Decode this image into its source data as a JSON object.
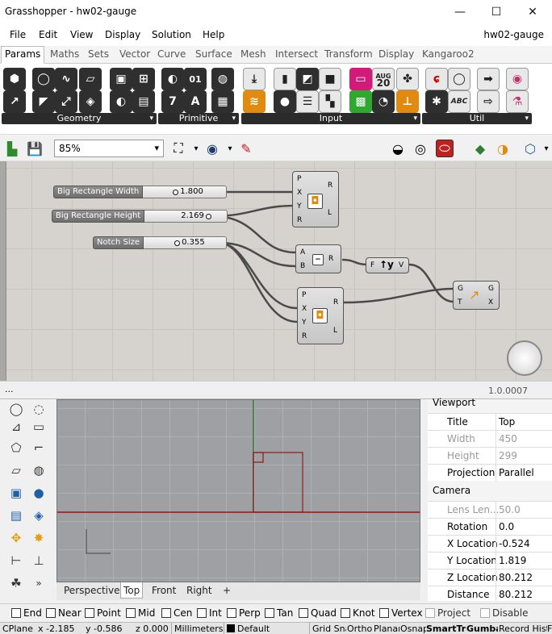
{
  "window": {
    "title": "Grasshopper - hw02-gauge",
    "minimize": "—",
    "maximize": "☐",
    "close": "✕"
  },
  "menu": {
    "items": [
      "File",
      "Edit",
      "View",
      "Display",
      "Solution",
      "Help"
    ],
    "doc_name": "hw02-gauge"
  },
  "tabs": [
    "Params",
    "Maths",
    "Sets",
    "Vector",
    "Curve",
    "Surface",
    "Mesh",
    "Intersect",
    "Transform",
    "Display",
    "Kangaroo2"
  ],
  "ribbon": {
    "panels": [
      "Geometry",
      "Primitive",
      "Input",
      "Util"
    ],
    "input_icons": {
      "calendar_month": "AUG",
      "calendar_day": "20",
      "abc": "ABC"
    },
    "primitive_icons": {
      "binary": "01",
      "seven": "7",
      "letter": "A"
    }
  },
  "toolbar": {
    "zoom": "85%"
  },
  "canvas": {
    "sliders": [
      {
        "label": "Big Rectangle Width",
        "value": "1.800"
      },
      {
        "label": "Big Rectangle Height",
        "value": "2.169"
      },
      {
        "label": "Notch Size",
        "value": "0.355"
      }
    ],
    "rect1": {
      "inputs": [
        "P",
        "X",
        "Y",
        "R"
      ],
      "outputs": [
        "R",
        "L"
      ]
    },
    "subtract": {
      "inputs": [
        "A",
        "B"
      ],
      "outputs": [
        "R"
      ],
      "symbol": "−"
    },
    "unit_y": {
      "inputs": [
        "F"
      ],
      "outputs": [
        "V"
      ],
      "symbol": "↑y"
    },
    "rect2": {
      "inputs": [
        "P",
        "X",
        "Y",
        "R"
      ],
      "outputs": [
        "R",
        "L"
      ]
    },
    "move": {
      "inputs": [
        "G",
        "T"
      ],
      "outputs": [
        "G",
        "X"
      ]
    },
    "status_dots": "...",
    "version": "1.0.0007"
  },
  "viewport": {
    "tabs": [
      "Perspective",
      "Top",
      "Front",
      "Right"
    ],
    "active_tab": "Top",
    "add_tab": "+"
  },
  "properties": {
    "viewport_header": "Viewport",
    "rows1": [
      {
        "k": "Title",
        "v": "Top",
        "dim": false
      },
      {
        "k": "Width",
        "v": "450",
        "dim": true
      },
      {
        "k": "Height",
        "v": "299",
        "dim": true
      },
      {
        "k": "Projection",
        "v": "Parallel",
        "dim": false
      }
    ],
    "camera_header": "Camera",
    "rows2": [
      {
        "k": "Lens Len...",
        "v": "50.0",
        "dim": true
      },
      {
        "k": "Rotation",
        "v": "0.0",
        "dim": false
      },
      {
        "k": "X Location",
        "v": "-0.524",
        "dim": false
      },
      {
        "k": "Y Location",
        "v": "1.819",
        "dim": false
      },
      {
        "k": "Z Location",
        "v": "80.212",
        "dim": false
      },
      {
        "k": "Distance",
        "v": "80.212",
        "dim": false
      }
    ]
  },
  "osnap": {
    "items": [
      "End",
      "Near",
      "Point",
      "Mid",
      "Cen",
      "Int",
      "Perp",
      "Tan",
      "Quad",
      "Knot",
      "Vertex"
    ],
    "dim_items": [
      "Project",
      "Disable"
    ]
  },
  "statusbar": {
    "cplane": "CPlane",
    "x": "x -2.185",
    "y": "y -0.586",
    "z": "z 0.000",
    "units": "Millimeters",
    "layer": "Default",
    "grid_snap": "Grid Snap",
    "ortho": "Ortho",
    "planar": "Planar",
    "osnap": "Osnap",
    "smarttrack": "SmartTrack",
    "gumball": "Gumball",
    "record_history": "Record History",
    "filter": "Filter"
  },
  "colors": {
    "wire": "#4a4a4a",
    "rect_red": "#8b1a1a",
    "axis_green": "#2e7d32",
    "axis_red": "#a01010"
  }
}
